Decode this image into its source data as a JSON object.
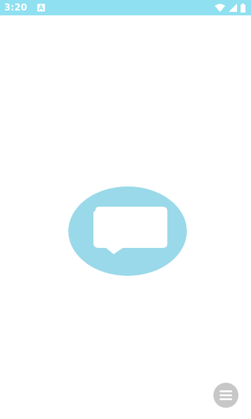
{
  "status_bar": {
    "time": "3:20",
    "background_color": "#8fe0f0",
    "icons": [
      "notification-a-icon",
      "wifi-icon",
      "signal-icon",
      "battery-icon"
    ]
  },
  "splash": {
    "logo_icon": "chat-bubble-icon",
    "ellipse_color": "#9ad9e9",
    "bubble_color": "#ffffff"
  },
  "fab": {
    "icon": "menu-lines-icon",
    "color": "#c7c7c7"
  }
}
